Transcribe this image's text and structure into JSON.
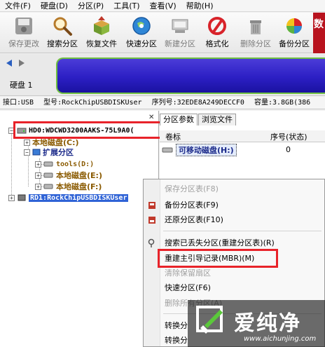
{
  "menu": [
    "文件(F)",
    "硬盘(D)",
    "分区(P)",
    "工具(T)",
    "查看(V)",
    "帮助(H)"
  ],
  "toolbar": {
    "buttons": [
      {
        "label": "保存更改",
        "icon": "save-icon",
        "enabled": false
      },
      {
        "label": "搜索分区",
        "icon": "magnifier-icon",
        "enabled": true
      },
      {
        "label": "恢复文件",
        "icon": "recover-box-icon",
        "enabled": true
      },
      {
        "label": "快速分区",
        "icon": "globe-disc-icon",
        "enabled": true
      },
      {
        "label": "新建分区",
        "icon": "new-partition-icon",
        "enabled": false
      },
      {
        "label": "格式化",
        "icon": "format-icon",
        "enabled": true
      },
      {
        "label": "删除分区",
        "icon": "trash-icon",
        "enabled": false
      },
      {
        "label": "备份分区",
        "icon": "backup-pie-icon",
        "enabled": true
      }
    ],
    "brand_char": "数"
  },
  "disk_panel": {
    "label": "硬盘 1"
  },
  "disk_info": {
    "interface": "接口:USB",
    "model": "型号:RockChipUSBDISKUser",
    "serial": "序列号:32EDE8A249DECCF0",
    "capacity": "容量:3.8GB(386"
  },
  "tree": {
    "hd0": "HD0:WDCWD3200AAKS-75L9A0(",
    "local_c": "本地磁盘(C:)",
    "extended": "扩展分区",
    "tools": "tools(D:)",
    "local_e": "本地磁盘(E:)",
    "local_f": "本地磁盘(F:)",
    "rd1": "RD1:RockChipUSBDISKUser"
  },
  "tabs": [
    "分区参数",
    "浏览文件"
  ],
  "columns": {
    "volume": "卷标",
    "seq": "序号(状态)"
  },
  "partition_row": {
    "label": "可移动磁盘(H:)",
    "seq": "0"
  },
  "context_menu": {
    "items": [
      {
        "label": "保存分区表(F8)",
        "enabled": false
      },
      {
        "label": "备份分区表(F9)",
        "enabled": true
      },
      {
        "label": "还原分区表(F10)",
        "enabled": true
      },
      {
        "label": "搜索已丢失分区(重建分区表)(R)",
        "enabled": true
      },
      {
        "label": "重建主引导记录(MBR)(M)",
        "enabled": true
      },
      {
        "label": "清除保留扇区",
        "enabled": false
      },
      {
        "label": "快速分区(F6)",
        "enabled": true
      },
      {
        "label": "删除所有分区(A)",
        "enabled": false
      },
      {
        "label": "转换分",
        "enabled": true
      },
      {
        "label": "转换分",
        "enabled": true
      }
    ]
  },
  "watermark": {
    "text": "爱纯净",
    "url": "www.aichunjing.com"
  },
  "highlight_color": "#e8232a"
}
